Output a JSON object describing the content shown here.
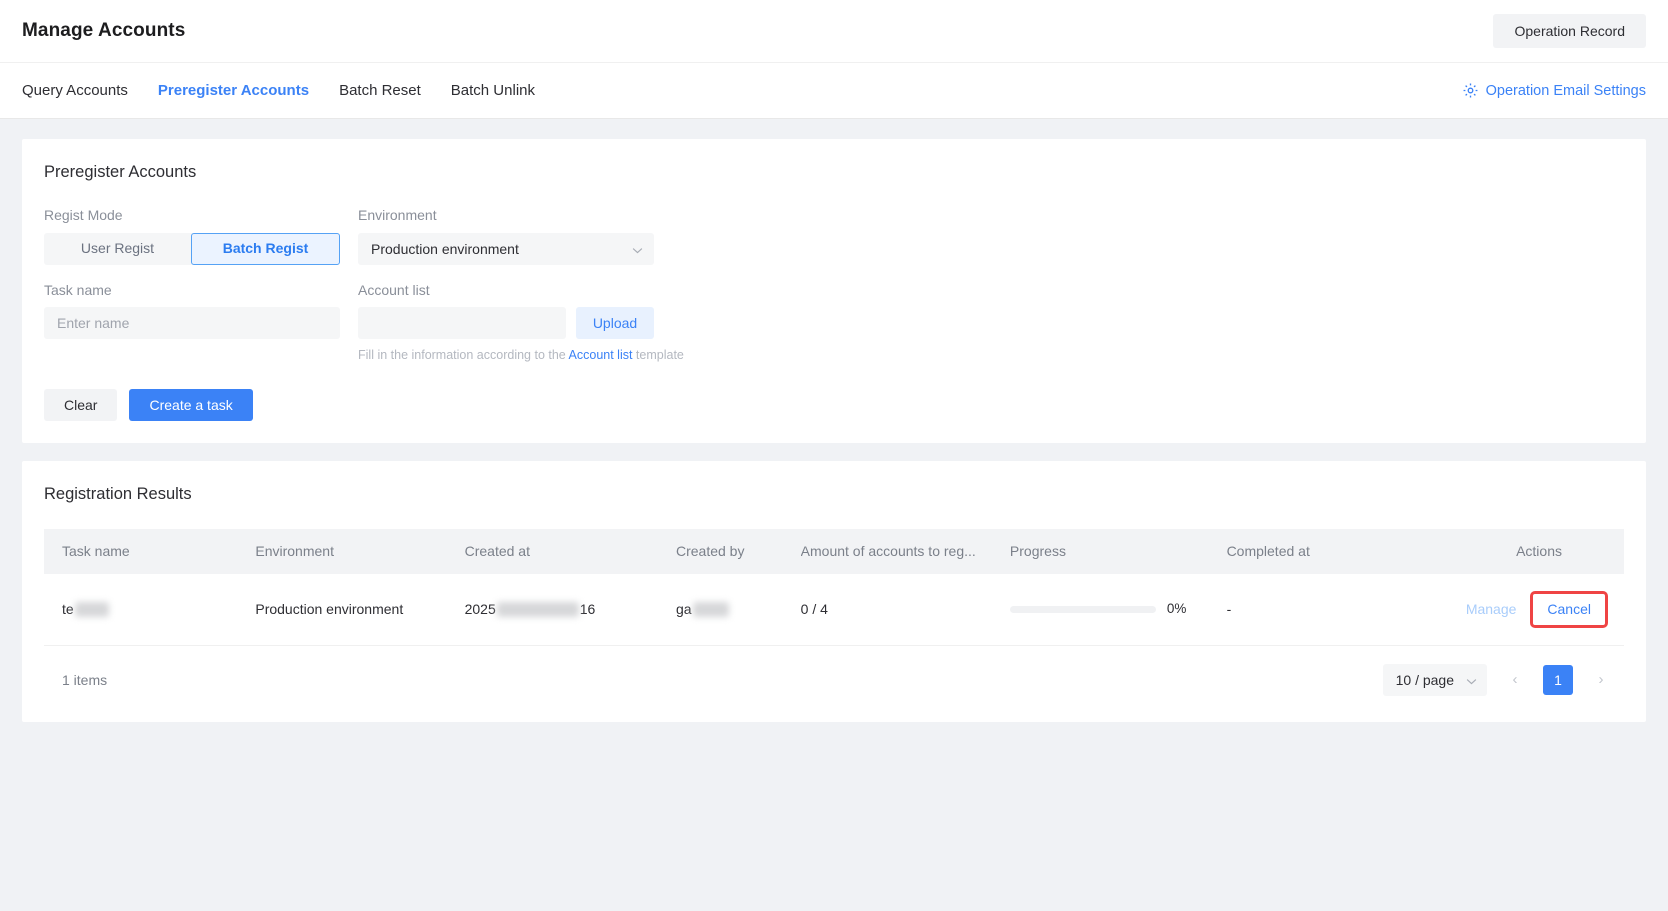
{
  "header": {
    "title": "Manage Accounts",
    "operation_record_label": "Operation Record"
  },
  "tabbar": {
    "tabs": [
      {
        "label": "Query Accounts",
        "active": false
      },
      {
        "label": "Preregister Accounts",
        "active": true
      },
      {
        "label": "Batch Reset",
        "active": false
      },
      {
        "label": "Batch Unlink",
        "active": false
      }
    ],
    "email_settings_label": "Operation Email Settings",
    "gear_icon": "gear-icon"
  },
  "form_card": {
    "title": "Preregister Accounts",
    "regist_mode": {
      "label": "Regist Mode",
      "options": [
        {
          "label": "User Regist",
          "active": false
        },
        {
          "label": "Batch Regist",
          "active": true
        }
      ]
    },
    "environment": {
      "label": "Environment",
      "value": "Production environment",
      "chevron_icon": "chevron-down-icon"
    },
    "task_name": {
      "label": "Task name",
      "value": "",
      "placeholder": "Enter name"
    },
    "account_list": {
      "label": "Account list",
      "value": "",
      "placeholder": "",
      "upload_label": "Upload",
      "hint_prefix": "Fill in the information according to the ",
      "hint_link": "Account list",
      "hint_suffix": " template"
    },
    "buttons": {
      "clear_label": "Clear",
      "create_label": "Create a task"
    }
  },
  "results_card": {
    "title": "Registration Results",
    "columns": [
      "Task name",
      "Environment",
      "Created at",
      "Created by",
      "Amount of accounts to reg...",
      "Progress",
      "Completed at",
      "Actions"
    ],
    "rows": [
      {
        "task_name_visible": "te",
        "task_name_redacted": true,
        "environment": "Production environment",
        "created_at_prefix": "2025",
        "created_at_suffix": "16",
        "created_at_redacted": true,
        "created_by_visible": "ga",
        "created_by_redacted": true,
        "amount": "0 / 4",
        "progress_percent": 0,
        "progress_label": "0%",
        "completed_at": "-",
        "action_manage": "Manage",
        "action_cancel": "Cancel"
      }
    ],
    "pagination": {
      "items_text": "1 items",
      "page_size": "10 / page",
      "prev_icon": "chevron-left-icon",
      "next_icon": "chevron-right-icon",
      "current_page": "1"
    }
  },
  "colors": {
    "accent": "#3b82f6",
    "highlight_box": "#ef4444",
    "page_bg": "#f0f2f5"
  }
}
